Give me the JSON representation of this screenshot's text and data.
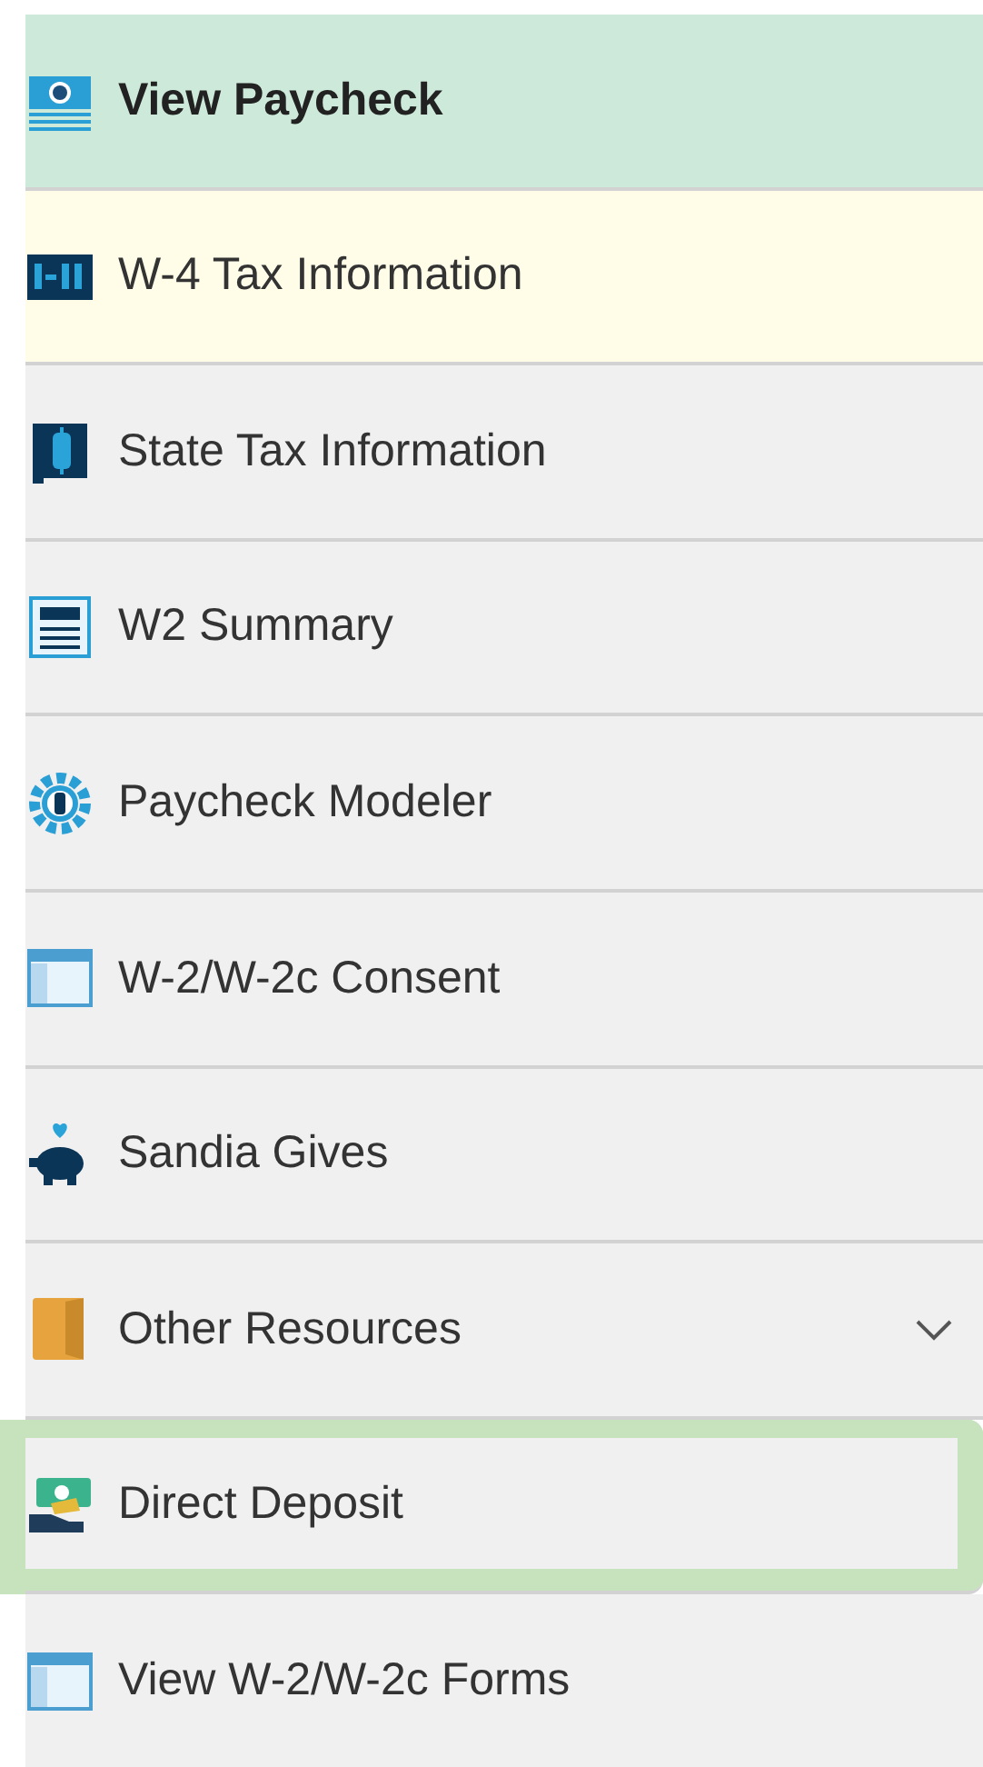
{
  "menu": [
    {
      "label": "View Paycheck",
      "selected": true,
      "highlighted": false,
      "focused": false
    },
    {
      "label": "W-4 Tax Information",
      "selected": false,
      "highlighted": true,
      "focused": false
    },
    {
      "label": "State Tax Information",
      "selected": false,
      "highlighted": false,
      "focused": false
    },
    {
      "label": "W2 Summary",
      "selected": false,
      "highlighted": false,
      "focused": false
    },
    {
      "label": "Paycheck Modeler",
      "selected": false,
      "highlighted": false,
      "focused": false
    },
    {
      "label": "W-2/W-2c Consent",
      "selected": false,
      "highlighted": false,
      "focused": false
    },
    {
      "label": "Sandia Gives",
      "selected": false,
      "highlighted": false,
      "focused": false
    },
    {
      "label": "Other Resources",
      "selected": false,
      "highlighted": false,
      "focused": false,
      "expanded": false
    },
    {
      "label": "Direct Deposit",
      "selected": false,
      "highlighted": false,
      "focused": true
    },
    {
      "label": "View W-2/W-2c Forms",
      "selected": false,
      "highlighted": false,
      "focused": false
    }
  ]
}
